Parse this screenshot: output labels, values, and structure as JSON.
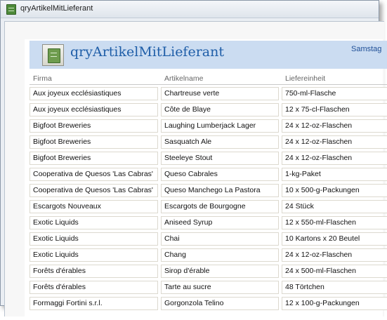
{
  "window": {
    "title": "qryArtikelMitLieferant",
    "icon": "table-icon"
  },
  "report": {
    "title": "qryArtikelMitLieferant",
    "date_partial": "Samstag",
    "icon": "report-icon",
    "columns": [
      "Firma",
      "Artikelname",
      "Liefereinheit"
    ],
    "rows": [
      {
        "firma": "Aux joyeux ecclésiastiques",
        "artikel": "Chartreuse verte",
        "einheit": "750-ml-Flasche"
      },
      {
        "firma": "Aux joyeux ecclésiastiques",
        "artikel": "Côte de Blaye",
        "einheit": "12 x 75-cl-Flaschen"
      },
      {
        "firma": "Bigfoot Breweries",
        "artikel": "Laughing Lumberjack Lager",
        "einheit": "24 x 12-oz-Flaschen"
      },
      {
        "firma": "Bigfoot Breweries",
        "artikel": "Sasquatch Ale",
        "einheit": "24 x 12-oz-Flaschen"
      },
      {
        "firma": "Bigfoot Breweries",
        "artikel": "Steeleye Stout",
        "einheit": "24 x 12-oz-Flaschen"
      },
      {
        "firma": "Cooperativa de Quesos 'Las Cabras'",
        "artikel": "Queso Cabrales",
        "einheit": "1-kg-Paket"
      },
      {
        "firma": "Cooperativa de Quesos 'Las Cabras'",
        "artikel": "Queso Manchego La Pastora",
        "einheit": "10 x 500-g-Packungen"
      },
      {
        "firma": "Escargots Nouveaux",
        "artikel": "Escargots de Bourgogne",
        "einheit": "24 Stück"
      },
      {
        "firma": "Exotic Liquids",
        "artikel": "Aniseed Syrup",
        "einheit": "12 x 550-ml-Flaschen"
      },
      {
        "firma": "Exotic Liquids",
        "artikel": "Chai",
        "einheit": "10 Kartons x 20 Beutel"
      },
      {
        "firma": "Exotic Liquids",
        "artikel": "Chang",
        "einheit": "24 x 12-oz-Flaschen"
      },
      {
        "firma": "Forêts d'érables",
        "artikel": "Sirop d'érable",
        "einheit": "24 x 500-ml-Flaschen"
      },
      {
        "firma": "Forêts d'érables",
        "artikel": "Tarte au sucre",
        "einheit": "48 Törtchen"
      },
      {
        "firma": "Formaggi Fortini s.r.l.",
        "artikel": "Gorgonzola Telino",
        "einheit": "12 x 100-g-Packungen"
      }
    ]
  },
  "colors": {
    "header_band": "#cbdcf1",
    "title_text": "#1f5ea8",
    "cell_border": "#dcd9cf"
  }
}
